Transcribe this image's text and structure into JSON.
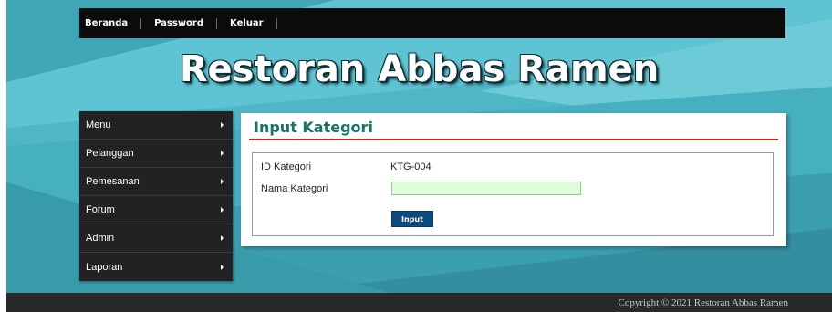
{
  "nav": {
    "links": [
      "Beranda",
      "Password",
      "Keluar"
    ]
  },
  "header": {
    "site_title": "Restoran Abbas Ramen"
  },
  "sidebar": {
    "items": [
      {
        "label": "Menu"
      },
      {
        "label": "Pelanggan"
      },
      {
        "label": "Pemesanan"
      },
      {
        "label": "Forum"
      },
      {
        "label": "Admin"
      },
      {
        "label": "Laporan"
      }
    ]
  },
  "main": {
    "title": "Input Kategori",
    "form": {
      "id_label": "ID Kategori",
      "id_value": "KTG-004",
      "name_label": "Nama Kategori",
      "name_value": "",
      "submit_label": "Input"
    }
  },
  "footer": {
    "copyright": "Copyright © 2021 Restoran Abbas Ramen"
  },
  "colors": {
    "background_teal": "#4fb6c6",
    "nav_bar": "#0b0b0b",
    "sidebar": "#222222",
    "title_green": "#15765f",
    "rule_red": "#d8231a",
    "button_blue": "#0d4a7d",
    "input_green": "#ddfddc",
    "footer": "#292929"
  }
}
